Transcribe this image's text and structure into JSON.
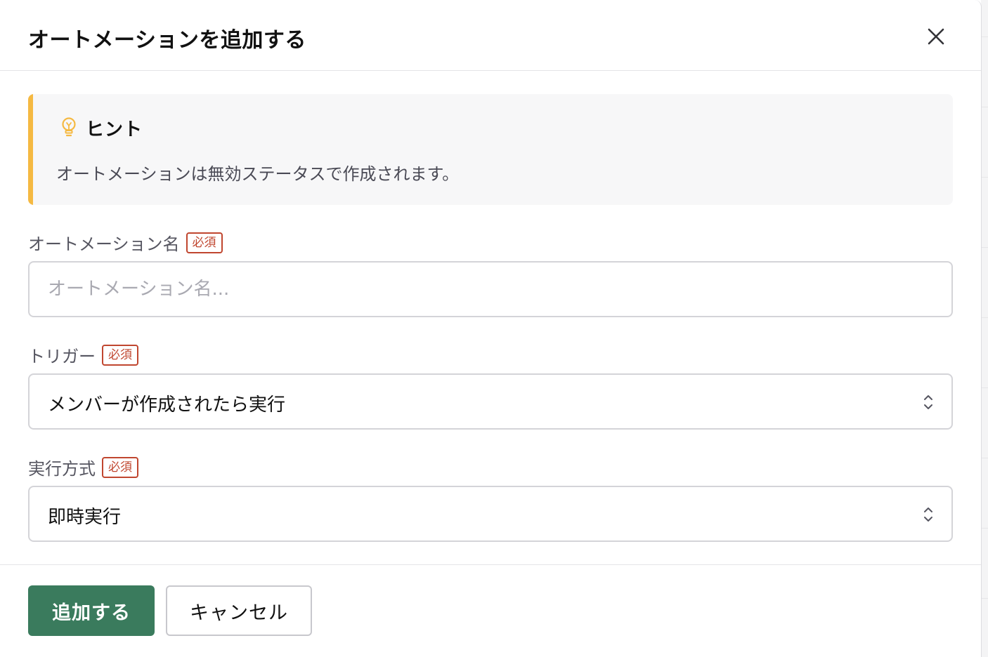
{
  "dialog": {
    "title": "オートメーションを追加する",
    "close_icon": "close-icon"
  },
  "hint": {
    "icon": "lightbulb-icon",
    "title": "ヒント",
    "text": "オートメーションは無効ステータスで作成されます。",
    "accent_color": "#f5b942"
  },
  "form": {
    "required_badge": "必須",
    "name_field": {
      "label": "オートメーション名",
      "value": "",
      "placeholder": "オートメーション名..."
    },
    "trigger_field": {
      "label": "トリガー",
      "selected": "メンバーが作成されたら実行"
    },
    "execution_field": {
      "label": "実行方式",
      "selected": "即時実行"
    }
  },
  "footer": {
    "submit_label": "追加する",
    "cancel_label": "キャンセル",
    "primary_color": "#3a7b5d"
  }
}
